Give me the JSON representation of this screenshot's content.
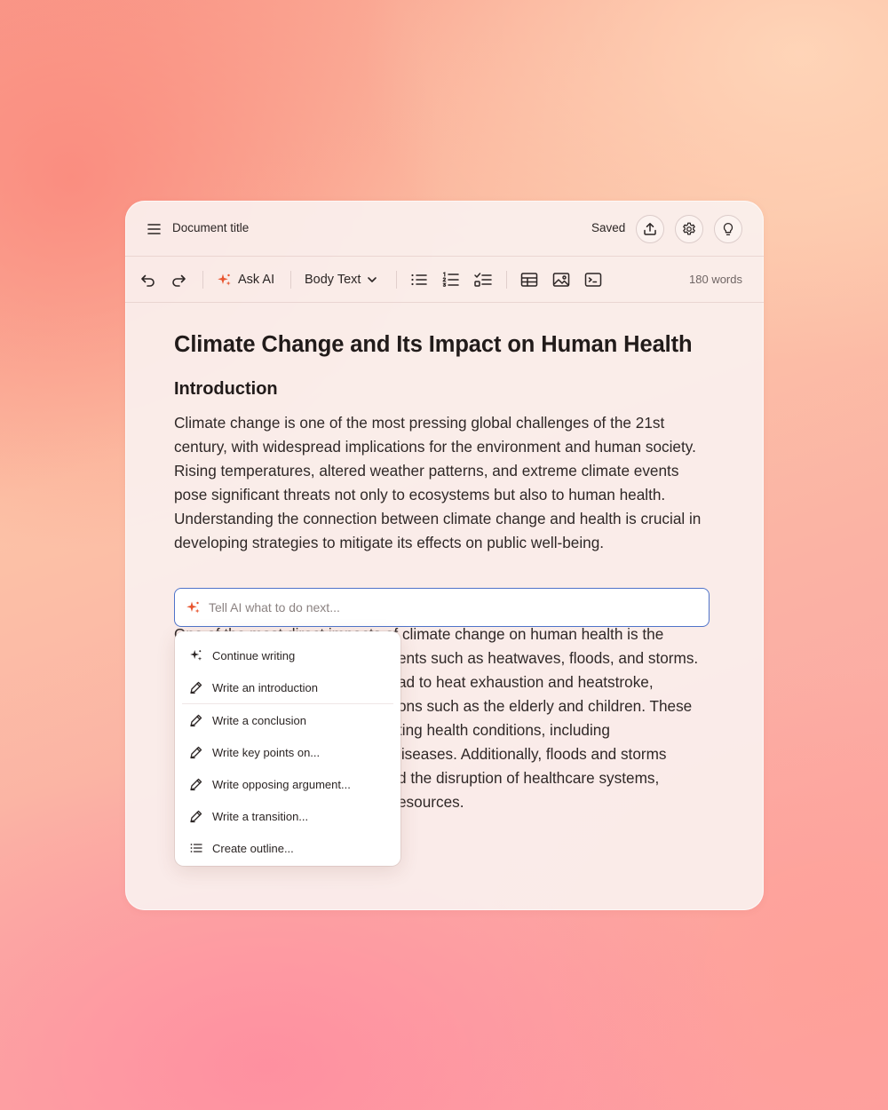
{
  "header": {
    "doc_title": "Document title",
    "save_status": "Saved",
    "icons": [
      "menu-icon",
      "upload-icon",
      "settings-icon",
      "lightbulb-icon"
    ]
  },
  "toolbar": {
    "ask_ai_label": "Ask AI",
    "text_style": "Body Text",
    "word_count": "180 words",
    "accent_color": "#e8552f"
  },
  "document": {
    "title": "Climate Change and Its Impact on Human Health",
    "section_heading": "Introduction",
    "paragraph1": "Climate change is one of the most pressing global challenges of the 21st century, with widespread implications for the environment and human society. Rising temperatures, altered weather patterns, and extreme climate events pose significant threats not only to ecosystems but also to human health. Understanding the connection between climate change and health is crucial in developing strategies to mitigate its effects on public well-being.",
    "paragraph2_lines": [
      "One of the most direct impacts of climate change on human health is the",
      "ents such as heatwaves, floods, and storms.",
      "ad to heat exhaustion and heatstroke,",
      "ons such as the elderly and children. These",
      "ting health conditions, including",
      "liseases. Additionally, floods and storms",
      "d the disruption of healthcare systems,",
      "esources."
    ]
  },
  "ai_prompt": {
    "placeholder": "Tell AI what to do next...",
    "value": ""
  },
  "ai_menu": {
    "items": [
      {
        "label": "Continue writing",
        "icon": "sparkle-icon"
      },
      {
        "label": "Write an introduction",
        "icon": "pen-icon"
      },
      {
        "label": "Write a conclusion",
        "icon": "pen-icon"
      },
      {
        "label": "Write key points on...",
        "icon": "pen-icon"
      },
      {
        "label": "Write opposing argument...",
        "icon": "pen-icon"
      },
      {
        "label": "Write a transition...",
        "icon": "pen-icon"
      },
      {
        "label": "Create outline...",
        "icon": "list-icon"
      }
    ]
  }
}
